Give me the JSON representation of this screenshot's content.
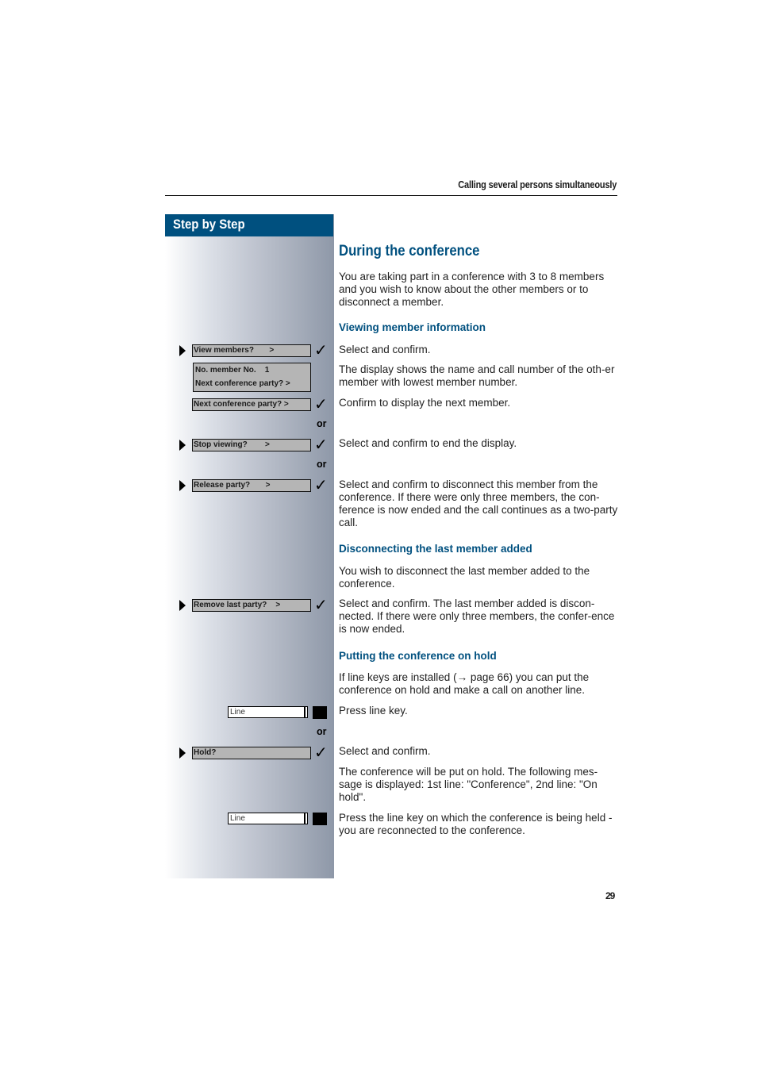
{
  "header": {
    "title": "Calling several persons simultaneously"
  },
  "sidebar": {
    "title": "Step by Step"
  },
  "main": {
    "title": "During the conference",
    "intro": "You are taking part in a conference with 3 to 8 members and you wish to know about the other members or to disconnect a member.",
    "sections": [
      {
        "heading": "Viewing member information"
      },
      {
        "heading": "Disconnecting the last member added"
      },
      {
        "heading": "Putting the conference on hold"
      }
    ],
    "texts": {
      "view_select": "Select and confirm.",
      "display_shows": "The display shows the name and call number of the oth-er member with lowest member number.",
      "confirm_next": "Confirm to display the next member.",
      "end_display": "Select and confirm to end the display.",
      "release": "Select and confirm to disconnect this member from the conference. If there were only three members, the con-ference is now ended and the call continues as a two-party call.",
      "wish_disconnect": "You wish to disconnect the last member added to the conference.",
      "remove_last": "Select and confirm. The last member added is discon-nected. If there were only three members, the confer-ence is now ended.",
      "line_keys": "If line keys are installed (→ page 66) you can put the conference on hold and make a call on another line.",
      "press_line": "Press line key.",
      "hold_select": "Select and confirm.",
      "hold_message": "The conference will be put on hold. The following mes-sage is displayed: 1st line:  \"Conference\", 2nd line: \"On hold\".",
      "reconnect": "Press the line key on which the conference is being held - you are reconnected to the conference."
    }
  },
  "steps": {
    "view_members": "View members?       >",
    "member_line1": "No. member No.    1",
    "member_line2": "Next conference party? >",
    "next_party": "Next conference party? >",
    "stop_viewing": "Stop viewing?        >",
    "release_party": "Release party?       >",
    "remove_last": "Remove last party?    >",
    "hold": "Hold?",
    "line_label": "Line",
    "or": "or"
  },
  "footer": {
    "page_number": "29"
  }
}
